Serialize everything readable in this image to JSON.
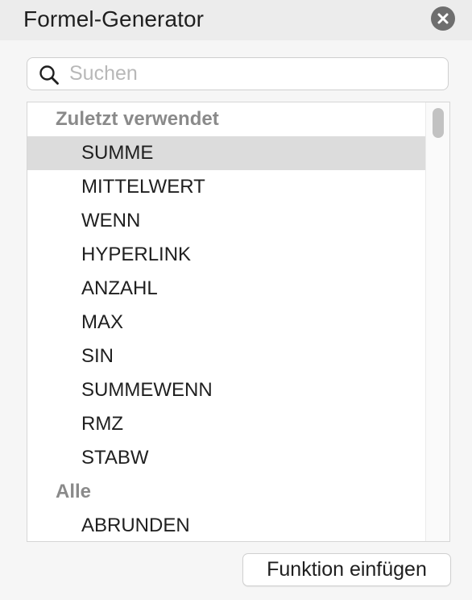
{
  "window": {
    "title": "Formel-Generator"
  },
  "search": {
    "placeholder": "Suchen",
    "value": ""
  },
  "function_list": {
    "sections": [
      {
        "header": "Zuletzt verwendet",
        "items": [
          {
            "label": "SUMME",
            "selected": true
          },
          {
            "label": "MITTELWERT",
            "selected": false
          },
          {
            "label": "WENN",
            "selected": false
          },
          {
            "label": "HYPERLINK",
            "selected": false
          },
          {
            "label": "ANZAHL",
            "selected": false
          },
          {
            "label": "MAX",
            "selected": false
          },
          {
            "label": "SIN",
            "selected": false
          },
          {
            "label": "SUMMEWENN",
            "selected": false
          },
          {
            "label": "RMZ",
            "selected": false
          },
          {
            "label": "STABW",
            "selected": false
          }
        ]
      },
      {
        "header": "Alle",
        "items": [
          {
            "label": "ABRUNDEN",
            "selected": false
          }
        ]
      }
    ]
  },
  "actions": {
    "insert_label": "Funktion einfügen"
  },
  "icons": {
    "close": "close-circle-icon",
    "search": "magnifier-icon"
  },
  "colors": {
    "header_bg": "#ececec",
    "selection_bg": "#dcdcdc",
    "section_header_text": "#8a8a8a"
  }
}
